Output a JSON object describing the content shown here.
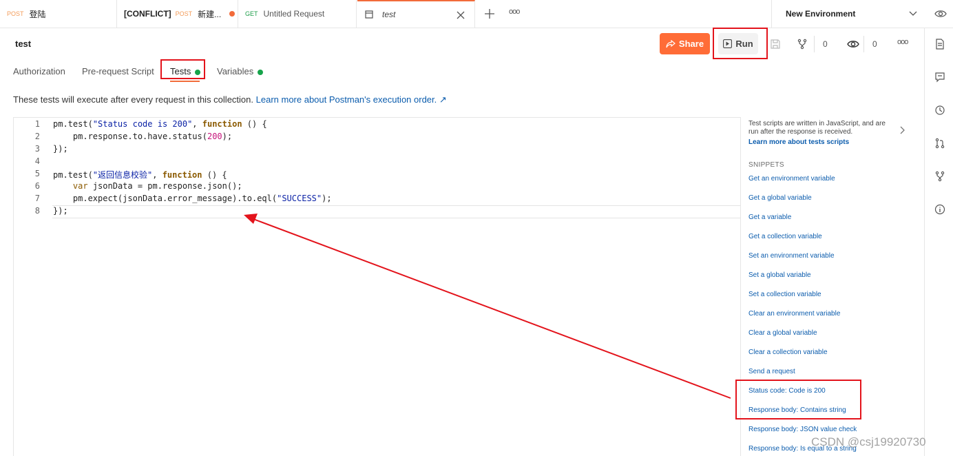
{
  "tabs": [
    {
      "method": "POST",
      "name": "登陆"
    },
    {
      "method": "POST",
      "prefix": "[CONFLICT]",
      "name": "新建..."
    },
    {
      "method": "GET",
      "name": "Untitled Request"
    },
    {
      "name": "test"
    }
  ],
  "overflow_label": "ooo",
  "environment": {
    "selected": "New Environment"
  },
  "header": {
    "title": "test",
    "share_label": "Share",
    "run_label": "Run",
    "fork_count": "0",
    "watch_count": "0"
  },
  "subtabs": [
    {
      "label": "Authorization"
    },
    {
      "label": "Pre-request Script"
    },
    {
      "label": "Tests"
    },
    {
      "label": "Variables"
    }
  ],
  "description": {
    "text": "These tests will execute after every request in this collection.",
    "link": "Learn more about Postman's execution order. ↗"
  },
  "editor": {
    "line_numbers": [
      "1",
      "2",
      "3",
      "4",
      "5",
      "6",
      "7",
      "8"
    ]
  },
  "right_panel": {
    "info": "Test scripts are written in JavaScript, and are run after the response is received.",
    "learn_link": "Learn more about tests scripts",
    "snippets_heading": "SNIPPETS",
    "snippets": [
      "Get an environment variable",
      "Get a global variable",
      "Get a variable",
      "Get a collection variable",
      "Set an environment variable",
      "Set a global variable",
      "Set a collection variable",
      "Clear an environment variable",
      "Clear a global variable",
      "Clear a collection variable",
      "Send a request",
      "Status code: Code is 200",
      "Response body: Contains string",
      "Response body: JSON value check",
      "Response body: Is equal to a string"
    ]
  },
  "watermark": "CSDN @csj19920730",
  "colors": {
    "accent": "#ff6c37",
    "highlight_box": "#e3131b",
    "link": "#0b5cad",
    "active_dot": "#16a34a"
  }
}
